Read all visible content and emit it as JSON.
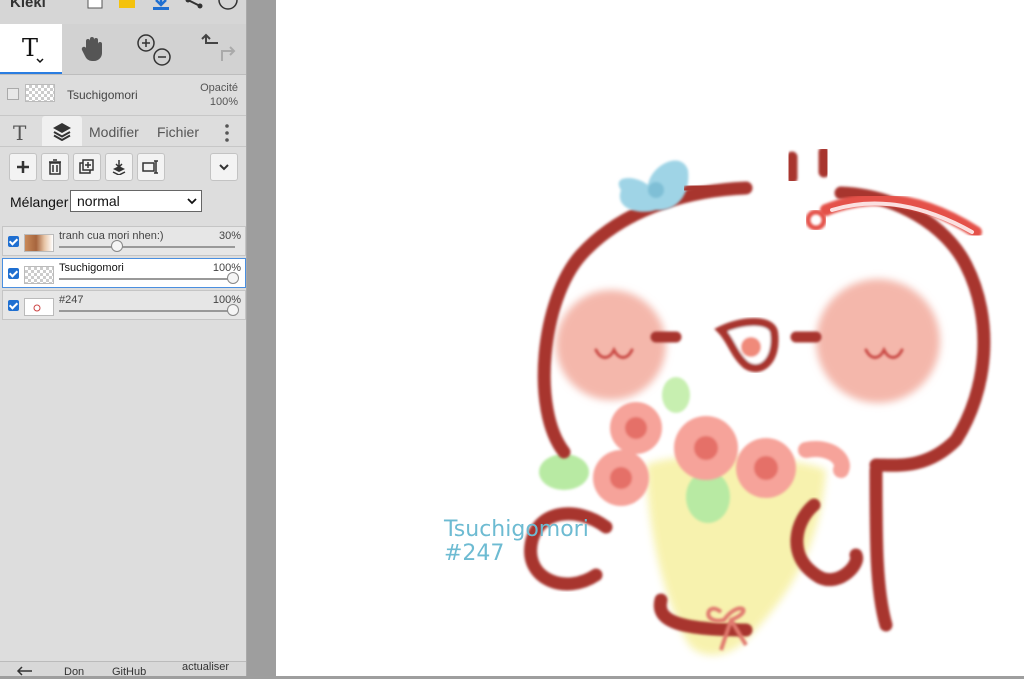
{
  "app": {
    "logo": "Kleki"
  },
  "layer_header": {
    "name": "Tsuchigomori",
    "opacity_label": "Opacité",
    "opacity_value": "100%"
  },
  "tabs": {
    "modifier": "Modifier",
    "fichier": "Fichier"
  },
  "blend": {
    "label": "Mélanger",
    "value": "normal"
  },
  "layers": [
    {
      "name": "tranh cua mori nhen:)",
      "opacity": "30%"
    },
    {
      "name": "Tsuchigomori",
      "opacity": "100%"
    },
    {
      "name": "#247",
      "opacity": "100%"
    }
  ],
  "footer": {
    "don": "Don",
    "github": "GitHub",
    "actualiser": "actualiser"
  },
  "canvas_text": {
    "line1": "Tsuchigomori",
    "line2": "#247"
  },
  "icons": [
    "file-icon",
    "folder-icon",
    "download-icon",
    "share-icon",
    "help-icon",
    "text-tool-icon",
    "hand-tool-icon",
    "zoom-in-icon",
    "zoom-out-icon",
    "undo-icon",
    "redo-icon",
    "add-layer-icon",
    "delete-layer-icon",
    "duplicate-layer-icon",
    "merge-layer-icon",
    "rename-layer-icon",
    "chevron-down-icon"
  ]
}
